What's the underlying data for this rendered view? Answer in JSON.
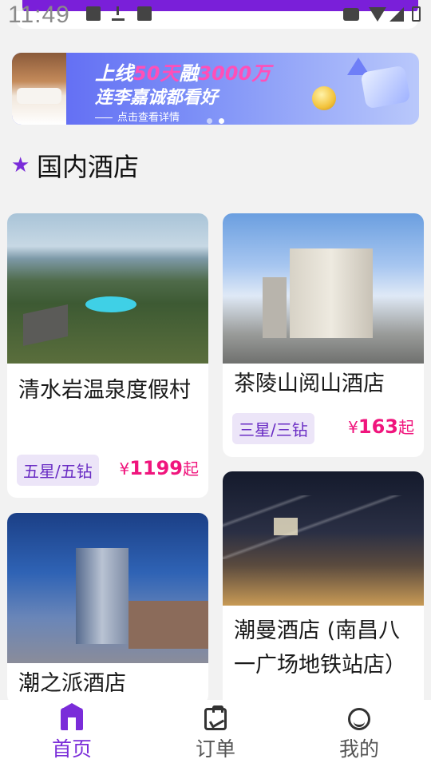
{
  "status_bar": {
    "time": "11:49"
  },
  "banner": {
    "line1_prefix": "上线",
    "line1_highlight1": "50天",
    "line1_mid": "融",
    "line1_highlight2": "3000万",
    "line2": "连李嘉诚都看好",
    "cta": "点击查看详情",
    "dot_count": 2,
    "active_dot": 1
  },
  "section": {
    "title": "国内酒店",
    "icon": "star-icon"
  },
  "hotels": [
    {
      "name": "清水岩温泉度假村",
      "rating": "五星/五钻",
      "price_symbol": "¥",
      "price": "1199",
      "price_suffix": "起"
    },
    {
      "name": "茶陵山阅山酒店",
      "rating": "三星/三钻",
      "price_symbol": "¥",
      "price": "163",
      "price_suffix": "起"
    },
    {
      "name": "潮之派酒店",
      "rating": "",
      "price": ""
    },
    {
      "name": "潮曼酒店 (南昌八一广场地铁站店）",
      "rating": "",
      "price": ""
    }
  ],
  "bottom_nav": {
    "items": [
      {
        "label": "首页",
        "icon": "home-icon",
        "active": true
      },
      {
        "label": "订单",
        "icon": "orders-icon",
        "active": false
      },
      {
        "label": "我的",
        "icon": "mine-icon",
        "active": false
      }
    ]
  },
  "colors": {
    "accent": "#7a2cd9",
    "price": "#f0157d",
    "badge_bg": "#ece5f8"
  }
}
